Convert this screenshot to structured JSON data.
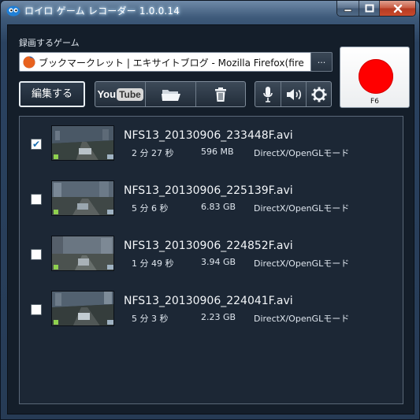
{
  "window": {
    "title": "ロイロ ゲーム レコーダー 1.0.0.14",
    "caption": {
      "minimize": "—",
      "maximize": "□",
      "close": "✕"
    }
  },
  "game_label": "録画するゲーム",
  "game_field_value": "ブックマークレット | エキサイトブログ - Mozilla Firefox(fire",
  "browse_label": "...",
  "record_key": "F6",
  "edit_label": "編集する",
  "youtube": {
    "you": "You",
    "tube": "Tube"
  },
  "colors": {
    "record": "#ff0000",
    "accent_check": "#1b6fb0",
    "list_bg": "#1c2735"
  },
  "icons": {
    "app": "roilo-logo-icon",
    "firefox": "firefox-icon",
    "folder": "folder-icon",
    "trash": "trash-icon",
    "mic": "microphone-icon",
    "speaker": "speaker-icon",
    "settings": "gear-icon"
  },
  "recordings": [
    {
      "filename": "NFS13_20130906_233448F.avi",
      "duration": "2 分 27 秒",
      "size": "596 MB",
      "mode": "DirectX/OpenGLモード",
      "checked": true
    },
    {
      "filename": "NFS13_20130906_225139F.avi",
      "duration": "5 分 6 秒",
      "size": "6.83 GB",
      "mode": "DirectX/OpenGLモード",
      "checked": false
    },
    {
      "filename": "NFS13_20130906_224852F.avi",
      "duration": "1 分 49 秒",
      "size": "3.94 GB",
      "mode": "DirectX/OpenGLモード",
      "checked": false
    },
    {
      "filename": "NFS13_20130906_224041F.avi",
      "duration": "5 分 3 秒",
      "size": "2.23 GB",
      "mode": "DirectX/OpenGLモード",
      "checked": false
    }
  ]
}
